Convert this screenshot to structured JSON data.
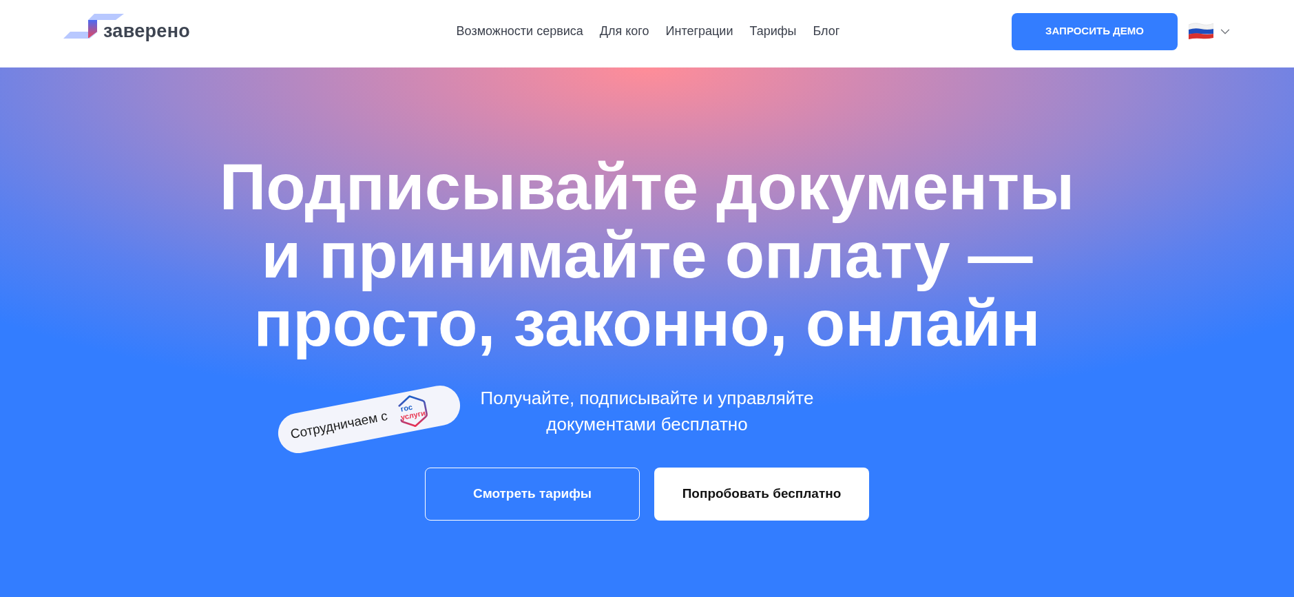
{
  "header": {
    "logo": {
      "wordmark": "заверено"
    },
    "nav": [
      {
        "label": "Возможности сервиса"
      },
      {
        "label": "Для кого"
      },
      {
        "label": "Интеграции"
      },
      {
        "label": "Тарифы"
      },
      {
        "label": "Блог"
      }
    ],
    "demo_button": {
      "label": "ЗАПРОСИТЬ ДЕМО"
    }
  },
  "hero": {
    "headline_lines": [
      "Подписывайте документы",
      "и принимайте оплату —",
      "просто, законно, онлайн"
    ],
    "subtitle_lines": [
      "Получайте, подписывайте и управляйте",
      "документами бесплатно"
    ],
    "partner_badge": {
      "text": "Сотрудничаем с",
      "logo_lines": [
        "гос",
        "услуги"
      ]
    },
    "buttons": [
      {
        "label": "Смотреть тарифы",
        "kind": "outline"
      },
      {
        "label": "Попробовать бесплатно",
        "kind": "solid"
      }
    ]
  }
}
